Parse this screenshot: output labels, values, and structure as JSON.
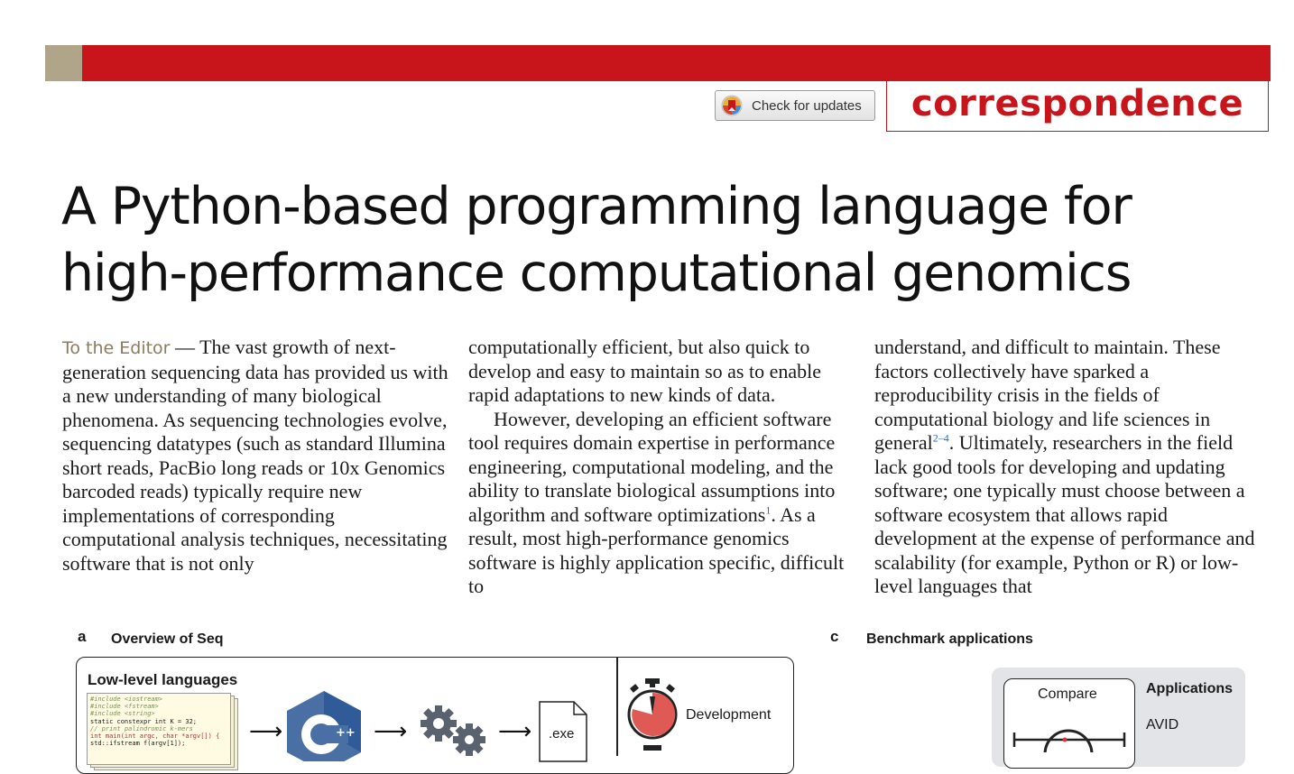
{
  "header": {
    "check_updates_label": "Check for updates",
    "section_label": "correspondence",
    "colors": {
      "accent_red": "#c8151c",
      "accent_tan": "#b1a589"
    }
  },
  "article": {
    "title_line1": "A Python-based programming language for",
    "title_line2": "high-performance computational genomics",
    "lead": "To the Editor",
    "col1": "— The vast growth of next-generation sequencing data has provided us with a new understanding of many biological phenomena. As sequencing technologies evolve, sequencing datatypes (such as standard Illumina short reads, PacBio long reads or 10x Genomics barcoded reads) typically require new implementations of corresponding computational analysis techniques, necessitating software that is not only",
    "col2_p1": "computationally efficient, but also quick to develop and easy to maintain so as to enable rapid adaptations to new kinds of data.",
    "col2_p2": "However, developing an efficient software tool requires domain expertise in performance engineering, computational modeling, and the ability to translate biological assumptions into algorithm and software optimizations",
    "col2_ref": "1",
    "col2_p2_rest": ". As a result, most high-performance genomics software is highly application specific, difficult to",
    "col3_p1": "understand, and difficult to maintain. These factors collectively have sparked a reproducibility crisis in the fields of computational biology and life sciences in general",
    "col3_ref": "2–4",
    "col3_p1_rest": ". Ultimately, researchers in the field lack good tools for developing and updating software; one typically must choose between a software ecosystem that allows rapid development at the expense of performance and scalability (for example, Python or R) or low-level languages that"
  },
  "figure": {
    "panel_a": {
      "letter": "a",
      "title": "Overview of Seq",
      "low_level_label": "Low-level languages",
      "code_lines": [
        "#include <iostream>",
        "#include <fstream>",
        "#include <string>",
        "static constexpr int K = 32;",
        "// print palindromic k-mers",
        "int main(int argc, char *argv[]) {",
        "  std::ifstream f(argv[1]);"
      ],
      "exe_label": ".exe",
      "development_label": "Development",
      "icons": [
        "cpp-logo-icon",
        "gears-icon",
        "file-icon",
        "stopwatch-icon"
      ]
    },
    "panel_c": {
      "letter": "c",
      "title": "Benchmark applications",
      "compare_label": "Compare",
      "applications_label": "Applications",
      "avid_label": "AVID"
    }
  }
}
